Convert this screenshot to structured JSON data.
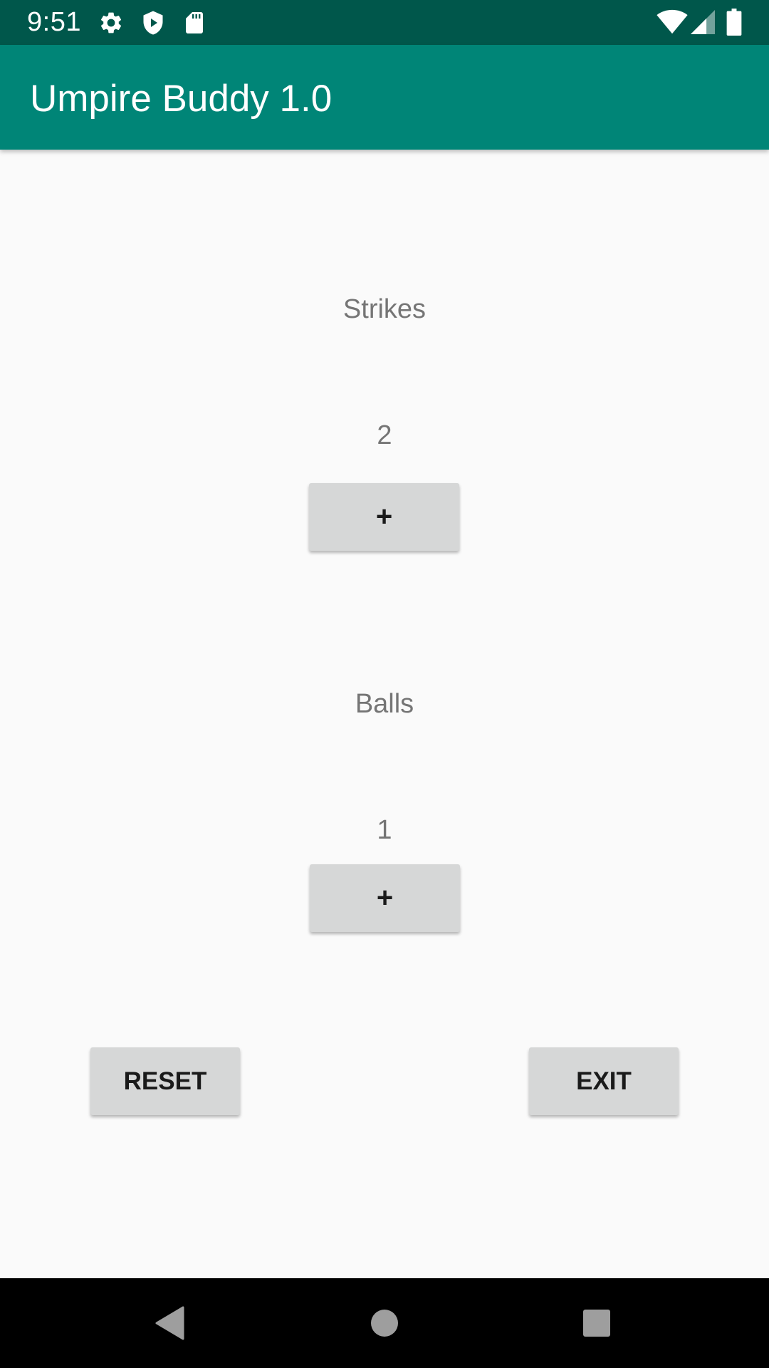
{
  "status_bar": {
    "time": "9:51",
    "left_icons": [
      "gear-icon",
      "shield-play-icon",
      "sd-card-icon"
    ],
    "right_icons": [
      "wifi-icon",
      "signal-icon",
      "battery-icon"
    ],
    "background": "#00574b"
  },
  "app_bar": {
    "title": "Umpire Buddy 1.0",
    "background": "#008577"
  },
  "strikes": {
    "label": "Strikes",
    "count": "2",
    "increment_label": "+"
  },
  "balls": {
    "label": "Balls",
    "count": "1",
    "increment_label": "+"
  },
  "actions": {
    "reset_label": "RESET",
    "exit_label": "EXIT"
  },
  "nav_bar": {
    "items": [
      "back-icon",
      "home-icon",
      "recents-icon"
    ]
  }
}
